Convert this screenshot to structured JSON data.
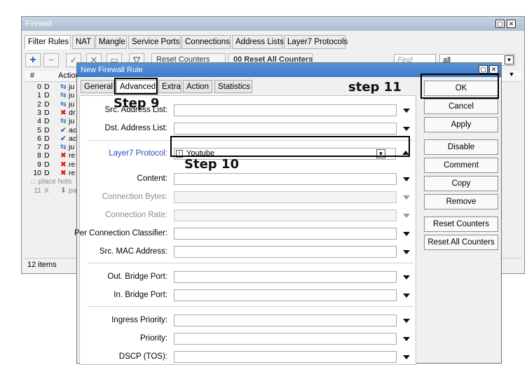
{
  "back_window": {
    "title": "Firewall",
    "tabs": [
      "Filter Rules",
      "NAT",
      "Mangle",
      "Service Ports",
      "Connections",
      "Address Lists",
      "Layer7 Protocols"
    ],
    "toolbar": {
      "reset_counters": "Reset Counters",
      "reset_all_counters": "00 Reset All Counters",
      "find_placeholder": "Find",
      "filter_value": "all"
    },
    "columns": {
      "number": "#",
      "action": "Action"
    },
    "rows": [
      {
        "num": "0",
        "flag": "D",
        "icon": "jump-icon",
        "action": "ju"
      },
      {
        "num": "1",
        "flag": "D",
        "icon": "jump-icon",
        "action": "ju"
      },
      {
        "num": "2",
        "flag": "D",
        "icon": "jump-icon",
        "action": "ju"
      },
      {
        "num": "3",
        "flag": "D",
        "icon": "drop-icon",
        "action": "dr"
      },
      {
        "num": "4",
        "flag": "D",
        "icon": "jump-icon",
        "action": "ju"
      },
      {
        "num": "5",
        "flag": "D",
        "icon": "accept-icon",
        "action": "ac"
      },
      {
        "num": "6",
        "flag": "D",
        "icon": "accept-icon",
        "action": "ac"
      },
      {
        "num": "7",
        "flag": "D",
        "icon": "jump-icon",
        "action": "ju"
      },
      {
        "num": "8",
        "flag": "D",
        "icon": "reject-icon",
        "action": "re"
      },
      {
        "num": "9",
        "flag": "D",
        "icon": "reject-icon",
        "action": "re"
      },
      {
        "num": "10",
        "flag": "D",
        "icon": "reject-icon",
        "action": "re"
      }
    ],
    "placeholder_row": "::: place hots",
    "disabled_row": {
      "num": "11",
      "flag": "X",
      "action": "pa"
    },
    "status": "12 items"
  },
  "dialog": {
    "title": "New Firewall Rule",
    "tabs": [
      "General",
      "Advanced",
      "Extra",
      "Action",
      "Statistics"
    ],
    "active_tab": "Advanced",
    "fields": {
      "src_address_list": "Src. Address List:",
      "dst_address_list": "Dst. Address List:",
      "layer7_protocol": "Layer7 Protocol:",
      "layer7_value": "Youtube",
      "content": "Content:",
      "connection_bytes": "Connection Bytes:",
      "connection_rate": "Connection Rate:",
      "per_connection_classifier": "Per Connection Classifier:",
      "src_mac_address": "Src. MAC Address:",
      "out_bridge_port": "Out. Bridge Port:",
      "in_bridge_port": "In. Bridge Port:",
      "ingress_priority": "Ingress Priority:",
      "priority": "Priority:",
      "dscp_tos": "DSCP (TOS):"
    },
    "buttons": {
      "ok": "OK",
      "cancel": "Cancel",
      "apply": "Apply",
      "disable": "Disable",
      "comment": "Comment",
      "copy": "Copy",
      "remove": "Remove",
      "reset_counters": "Reset Counters",
      "reset_all_counters": "Reset All Counters"
    }
  },
  "annotations": {
    "step9": "Step 9",
    "step10": "Step 10",
    "step11": "step 11"
  },
  "colors": {
    "dialog_title_bar": "#3c7bca",
    "link_label": "#2a4db7"
  }
}
